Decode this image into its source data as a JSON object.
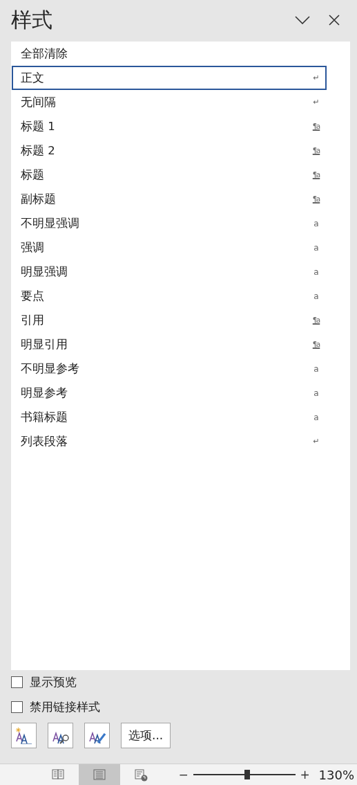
{
  "pane": {
    "title": "样式"
  },
  "styles": [
    {
      "name": "全部清除",
      "kind": "clear",
      "selected": false
    },
    {
      "name": "正文",
      "kind": "paragraph",
      "mark": "↵",
      "selected": true
    },
    {
      "name": "无间隔",
      "kind": "paragraph",
      "mark": "↵",
      "selected": false
    },
    {
      "name": "标题 1",
      "kind": "linked",
      "mark": "¶a",
      "selected": false
    },
    {
      "name": "标题 2",
      "kind": "linked",
      "mark": "¶a",
      "selected": false
    },
    {
      "name": "标题",
      "kind": "linked",
      "mark": "¶a",
      "selected": false
    },
    {
      "name": "副标题",
      "kind": "linked",
      "mark": "¶a",
      "selected": false
    },
    {
      "name": "不明显强调",
      "kind": "character",
      "mark": "a",
      "selected": false
    },
    {
      "name": "强调",
      "kind": "character",
      "mark": "a",
      "selected": false
    },
    {
      "name": "明显强调",
      "kind": "character",
      "mark": "a",
      "selected": false
    },
    {
      "name": "要点",
      "kind": "character",
      "mark": "a",
      "selected": false
    },
    {
      "name": "引用",
      "kind": "linked",
      "mark": "¶a",
      "selected": false
    },
    {
      "name": "明显引用",
      "kind": "linked",
      "mark": "¶a",
      "selected": false
    },
    {
      "name": "不明显参考",
      "kind": "character",
      "mark": "a",
      "selected": false
    },
    {
      "name": "明显参考",
      "kind": "character",
      "mark": "a",
      "selected": false
    },
    {
      "name": "书籍标题",
      "kind": "character",
      "mark": "a",
      "selected": false
    },
    {
      "name": "列表段落",
      "kind": "paragraph",
      "mark": "↵",
      "selected": false
    }
  ],
  "options": [
    {
      "label": "显示预览",
      "checked": false
    },
    {
      "label": "禁用链接样式",
      "checked": false
    }
  ],
  "buttons": [
    {
      "kind": "new-style"
    },
    {
      "kind": "inspector"
    },
    {
      "kind": "manage"
    },
    {
      "kind": "text",
      "label": "选项..."
    }
  ],
  "status_bar": {
    "views": [
      {
        "kind": "read",
        "selected": false
      },
      {
        "kind": "print",
        "selected": true
      },
      {
        "kind": "web",
        "selected": false
      }
    ],
    "zoom": {
      "minus": "−",
      "plus": "+",
      "level": 0.53,
      "reading": "130%"
    }
  }
}
